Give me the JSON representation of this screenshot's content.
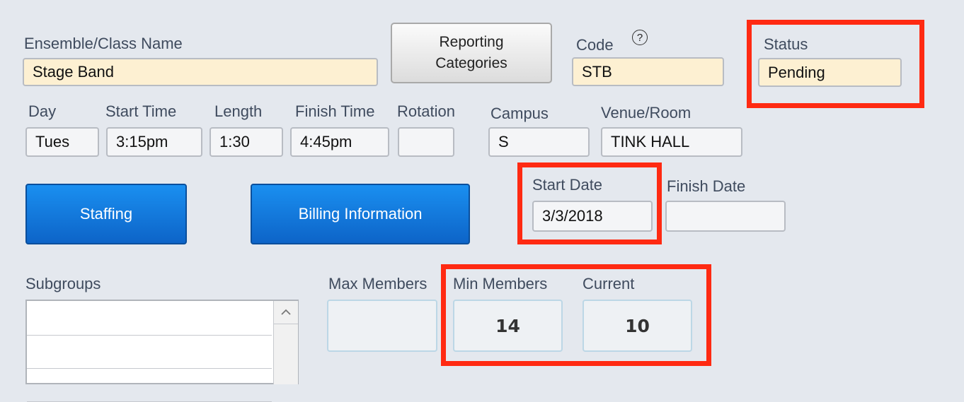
{
  "fields": {
    "ensemble_name": {
      "label": "Ensemble/Class Name",
      "value": "Stage Band"
    },
    "code": {
      "label": "Code",
      "value": "STB"
    },
    "status": {
      "label": "Status",
      "value": "Pending"
    },
    "day": {
      "label": "Day",
      "value": "Tues"
    },
    "start_time": {
      "label": "Start Time",
      "value": "3:15pm"
    },
    "length": {
      "label": "Length",
      "value": "1:30"
    },
    "finish_time": {
      "label": "Finish Time",
      "value": "4:45pm"
    },
    "rotation": {
      "label": "Rotation",
      "value": ""
    },
    "campus": {
      "label": "Campus",
      "value": "S"
    },
    "venue": {
      "label": "Venue/Room",
      "value": "TINK HALL"
    },
    "start_date": {
      "label": "Start Date",
      "value": "3/3/2018"
    },
    "finish_date": {
      "label": "Finish Date",
      "value": ""
    }
  },
  "buttons": {
    "reporting_line1": "Reporting",
    "reporting_line2": "Categories",
    "staffing": "Staffing",
    "billing": "Billing Information",
    "help_symbol": "?"
  },
  "subgroups": {
    "label": "Subgroups",
    "items": [
      "",
      "",
      ""
    ]
  },
  "members": {
    "max_label": "Max Members",
    "max_value": "",
    "min_label": "Min Members",
    "min_value": "14",
    "current_label": "Current",
    "current_value": "10"
  },
  "colors": {
    "highlight": "#ff2a12",
    "required_field": "#fdf0d2",
    "button_blue": "#0d64c8"
  },
  "icons": {
    "help": "help-circle-icon",
    "scroll_up": "chevron-up-icon"
  }
}
